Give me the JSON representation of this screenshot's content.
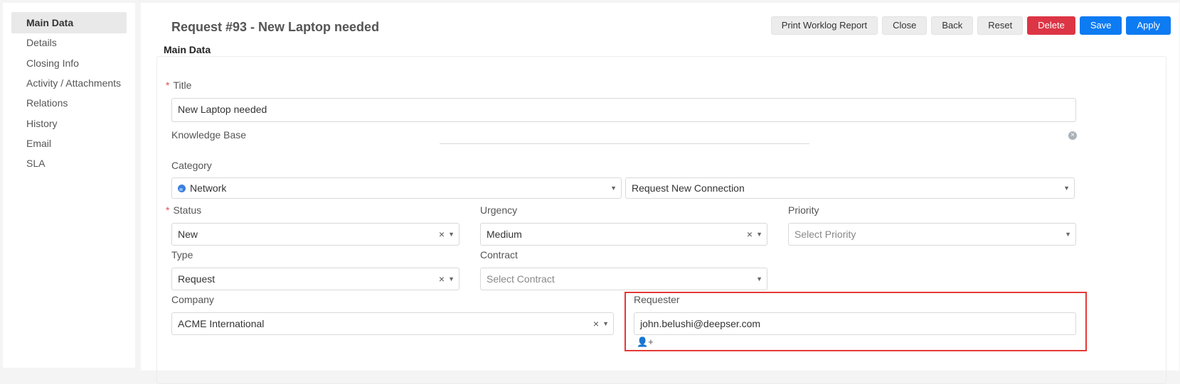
{
  "sidebar": {
    "items": [
      {
        "label": "Main Data",
        "active": true
      },
      {
        "label": "Details"
      },
      {
        "label": "Closing Info"
      },
      {
        "label": "Activity / Attachments"
      },
      {
        "label": "Relations"
      },
      {
        "label": "History"
      },
      {
        "label": "Email"
      },
      {
        "label": "SLA"
      }
    ]
  },
  "header": {
    "title": "Request #93 - New Laptop needed",
    "buttons": {
      "print": "Print Worklog Report",
      "close": "Close",
      "back": "Back",
      "reset": "Reset",
      "delete": "Delete",
      "save": "Save",
      "apply": "Apply"
    },
    "colors": {
      "delete": "#dc3545",
      "primary": "#0d7bf2"
    }
  },
  "main": {
    "section_title": "Main Data",
    "required_marker": "*",
    "title_field": {
      "label": "Title",
      "value": "New Laptop needed"
    },
    "knowledge_base": {
      "label": "Knowledge Base",
      "clear_icon": "×"
    },
    "category": {
      "label": "Category",
      "value": "Network",
      "subcategory": "Request New Connection"
    },
    "status": {
      "label": "Status",
      "value": "New"
    },
    "urgency": {
      "label": "Urgency",
      "value": "Medium"
    },
    "priority": {
      "label": "Priority",
      "placeholder": "Select Priority"
    },
    "type": {
      "label": "Type",
      "value": "Request"
    },
    "contract": {
      "label": "Contract",
      "placeholder": "Select Contract"
    },
    "company": {
      "label": "Company",
      "value": "ACME International"
    },
    "requester": {
      "label": "Requester",
      "value": "john.belushi@deepser.com",
      "add_icon": "user-plus-icon"
    }
  },
  "glyphs": {
    "caret": "▼",
    "clear": "×",
    "user_plus": "👤+"
  },
  "highlight_color": "#e53935"
}
